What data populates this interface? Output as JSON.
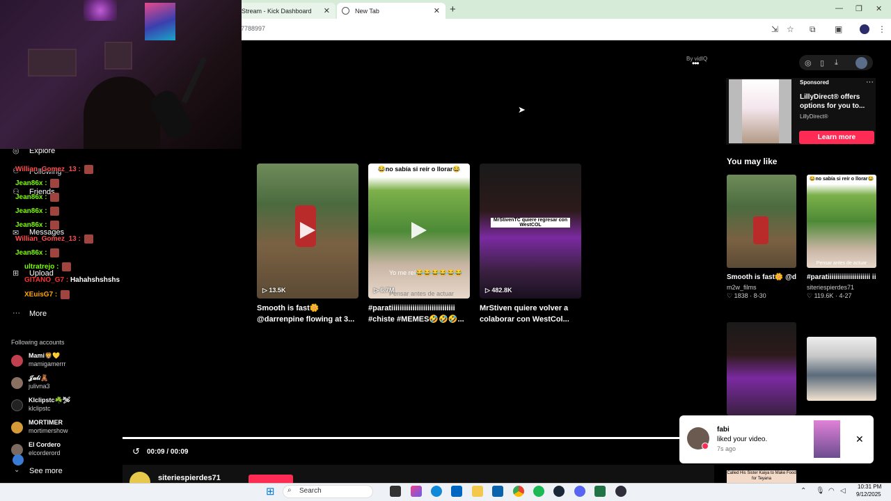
{
  "browser": {
    "tabs": [
      {
        "label": "Stream - Kick Dashboard"
      },
      {
        "label": "New Tab"
      }
    ],
    "url_fragment": "7788997"
  },
  "left_nav": {
    "items": [
      {
        "label": "Explore",
        "icon": "compass-icon"
      },
      {
        "label": "Following",
        "icon": "user-follow-icon"
      },
      {
        "label": "Friends",
        "icon": "friends-icon"
      },
      {
        "label": "Messages",
        "icon": "message-icon"
      },
      {
        "label": "Upload",
        "icon": "plus-square-icon"
      },
      {
        "label": "More",
        "icon": "more-dots-icon"
      }
    ],
    "following_header": "Following accounts",
    "accounts": [
      {
        "name": "Mami🦁💛",
        "handle": "mamigamerrr"
      },
      {
        "name": "𝒥𝓊𝓁𝒾🧸",
        "handle": "julivna3"
      },
      {
        "name": "Klclipstc☘️🛩",
        "handle": "klclipstc"
      },
      {
        "name": "MORTIMER",
        "handle": "mortimershow"
      },
      {
        "name": "El Cordero",
        "handle": "elcorderord"
      }
    ],
    "see_more": "See more"
  },
  "chat": [
    {
      "user": "Willian_Gomez_13",
      "color": "#ff4d4d",
      "text": ""
    },
    {
      "user": "Jean86x",
      "color": "#7cfc00",
      "text": ""
    },
    {
      "user": "Jean86x",
      "color": "#7cfc00",
      "text": ""
    },
    {
      "user": "Jean86x",
      "color": "#7cfc00",
      "text": ""
    },
    {
      "user": "Jean86x",
      "color": "#7cfc00",
      "text": ""
    },
    {
      "user": "Willian_Gomez_13",
      "color": "#ff4d4d",
      "text": ""
    },
    {
      "user": "Jean86x",
      "color": "#7cfc00",
      "text": ""
    },
    {
      "user": "ultratrejo",
      "color": "#7cfc00",
      "text": ""
    },
    {
      "user": "GITANO_G7",
      "color": "#ff3030",
      "text": "Hahahshshshs"
    },
    {
      "user": "XEuisG7",
      "color": "#ffa500",
      "text": ""
    }
  ],
  "main": {
    "by_vidiq": "By vidIQ",
    "videos": [
      {
        "views": "13.5K",
        "title1": "Smooth is fast🌼",
        "title2": "@darrenpine flowing at 3...",
        "overlay": ""
      },
      {
        "views": "6.7M",
        "title1": "#paratiiiiiiiiiiiiiiiiiiiiiiiiiiiiii",
        "title2": "#chiste #MEMES🤣🤣🤣...",
        "overlay": "😂no sabía si reír o llorar😂",
        "caption": "Yo me reí😂😂😂😂😂😂",
        "caption2": "Pensar antes de actuar"
      },
      {
        "views": "482.8K",
        "title1": "MrStiven quiere volver a",
        "title2": "colaborar con WestCol...",
        "overlay": "MrStivenTC quiere regresar con WestCOL"
      }
    ],
    "time": "00:09 / 00:09",
    "author": "siteriespierdes71",
    "progress": 1.0
  },
  "right_rail": {
    "ad": {
      "sponsored": "Sponsored",
      "text": "LillyDirect® offers options for you to...",
      "brand": "LillyDirect®",
      "cta": "Learn more"
    },
    "you_may_like": "You may like",
    "cards": [
      {
        "title": "Smooth is fast🌼 @darrenpine flowin...",
        "author": "m2w_films",
        "likes": "1838",
        "date": "8-30"
      },
      {
        "title": "#paratiiiiiiiiiiiiiiiiiiiiii iiiii #chiste #MEME...",
        "author": "siteriespierdes71",
        "likes": "119.6K",
        "date": "4-27",
        "caption": "Pensar antes de actuar"
      },
      {
        "title": "",
        "author": "",
        "likes": "",
        "date": ""
      },
      {
        "title": "",
        "author": "",
        "likes": "",
        "date": ""
      }
    ],
    "bottom_snippet": "Called His Sister Kaiya to Make Food for Teyana"
  },
  "notification": {
    "name": "fabi",
    "message": "liked your video.",
    "time": "7s ago"
  },
  "taskbar": {
    "search": "Search",
    "time": "10:31 PM",
    "date": "9/12/2025"
  },
  "colors": {
    "accent": "#fe2c55",
    "chrome": "#d6ecd9"
  }
}
